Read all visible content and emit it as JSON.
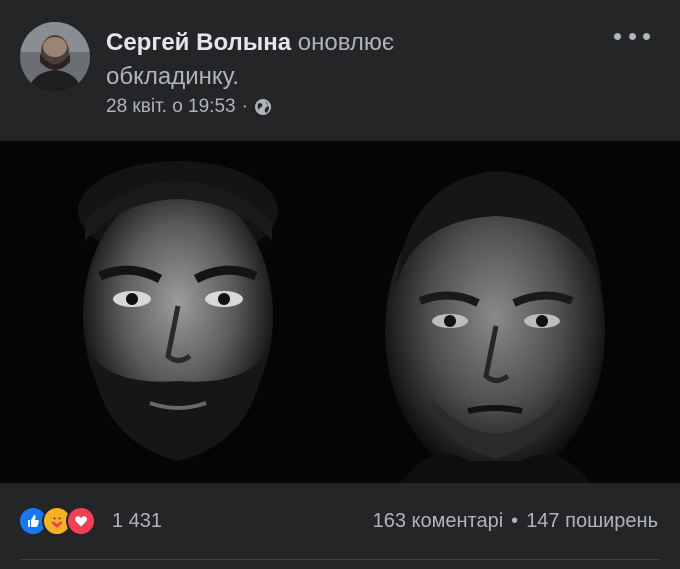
{
  "post": {
    "author": "Сергей Волына",
    "action_part1": "оновлює",
    "action_part2": "обкладинку.",
    "date": "28 квіт. о 19:53",
    "separator": "·",
    "audience_icon": "globe-icon",
    "more_icon": "more-horizontal-icon"
  },
  "footer": {
    "reaction_icons": [
      "like-icon",
      "care-icon",
      "love-icon"
    ],
    "reaction_count": "1 431",
    "comments": "163 коментарі",
    "dot": "•",
    "shares": "147 поширень"
  },
  "colors": {
    "background": "#242526",
    "text_primary": "#e4e6eb",
    "text_secondary": "#b0b3b8",
    "like_blue": "#1877f2",
    "love_red": "#f33e58",
    "care_yellow": "#f7b125"
  }
}
